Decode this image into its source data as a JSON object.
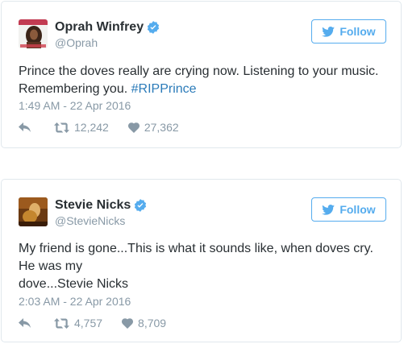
{
  "tweets": [
    {
      "display_name": "Oprah Winfrey",
      "handle": "@Oprah",
      "follow_label": "Follow",
      "text_before": "Prince the doves really are crying now. Listening to your music. Remembering you. ",
      "hashtag": "#RIPPrince",
      "text_after": "",
      "timestamp": "1:49 AM - 22 Apr 2016",
      "retweets": "12,242",
      "likes": "27,362",
      "verified_icon": "verified-badge-icon",
      "avatar_icon": "profile-photo"
    },
    {
      "display_name": "Stevie Nicks",
      "handle": "@StevieNicks",
      "follow_label": "Follow",
      "text_line1": "My friend is gone...This is what it sounds like, when doves cry. He was my",
      "text_line2": "dove...Stevie Nicks",
      "timestamp": "2:03 AM - 22 Apr 2016",
      "retweets": "4,757",
      "likes": "8,709",
      "verified_icon": "verified-badge-icon",
      "avatar_icon": "profile-photo"
    }
  ],
  "colors": {
    "accent": "#55acee",
    "hashtag": "#2b7bb9",
    "text": "#292f33",
    "muted": "#8899a6",
    "border": "#e1e8ed"
  }
}
